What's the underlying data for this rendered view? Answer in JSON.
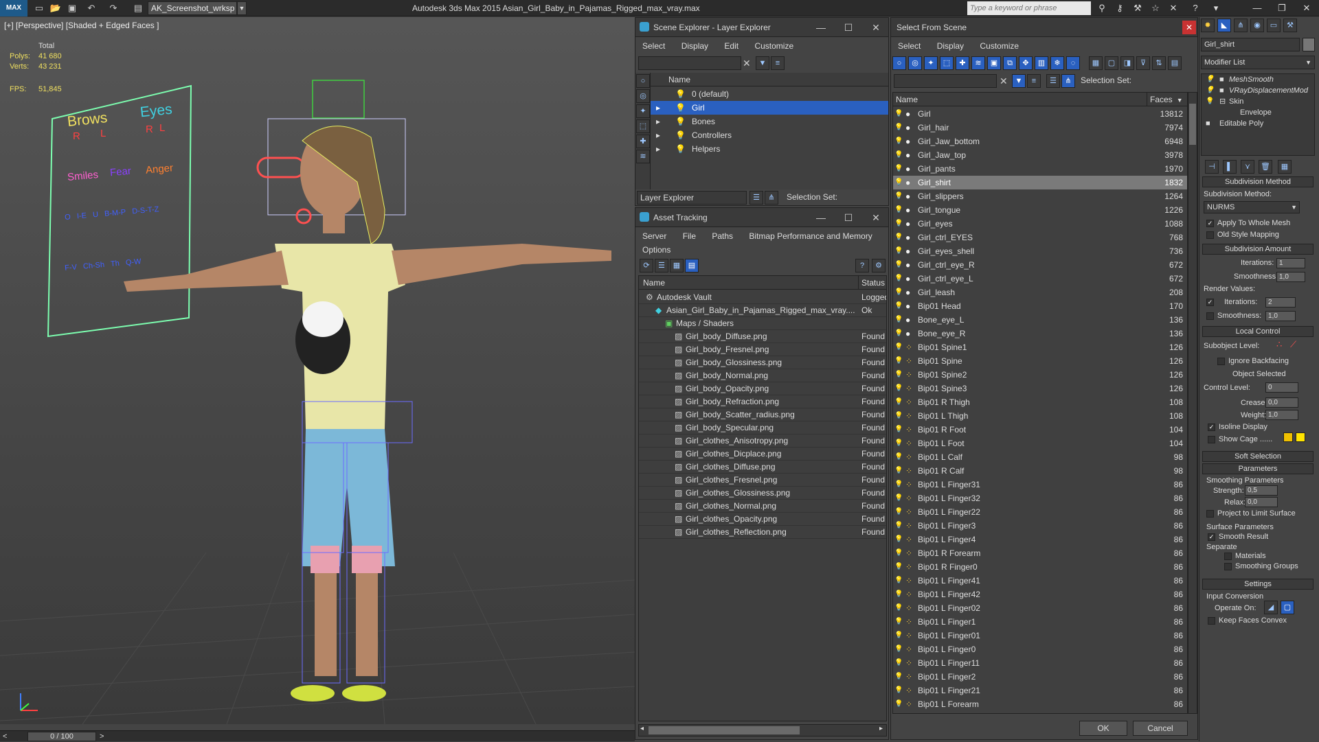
{
  "titlebar": {
    "logo": "MAX",
    "workspace": "AK_Screenshot_wrksp",
    "app_title": "Autodesk 3ds Max  2015     Asian_Girl_Baby_in_Pajamas_Rigged_max_vray.max",
    "search_placeholder": "Type a keyword or phrase"
  },
  "viewport": {
    "label": "[+] [Perspective] [Shaded + Edged Faces ]",
    "stats": {
      "total_label": "Total",
      "polys_label": "Polys:",
      "polys": "41 680",
      "verts_label": "Verts:",
      "verts": "43 231",
      "fps_label": "FPS:",
      "fps": "51,845"
    },
    "facial_panel": {
      "brows": "Brows",
      "eyes": "Eyes",
      "r1": "R",
      "l1": "L",
      "r2": "R",
      "l2": "L",
      "smiles": "Smiles",
      "fear": "Fear",
      "anger": "Anger",
      "row3": [
        "O",
        "I-E",
        "U",
        "B-M-P",
        "D-S-T-Z"
      ],
      "row4": [
        "F-V",
        "Ch-Sh",
        "Th",
        "Q-W"
      ]
    },
    "timeline": "0 / 100"
  },
  "scene_explorer": {
    "title": "Scene Explorer - Layer Explorer",
    "menu": [
      "Select",
      "Display",
      "Edit",
      "Customize"
    ],
    "column": "Name",
    "layers": [
      "0 (default)",
      "Girl",
      "Bones",
      "Controllers",
      "Helpers"
    ],
    "footer_dropdown": "Layer Explorer",
    "selection_set": "Selection Set:"
  },
  "asset_tracking": {
    "title": "Asset Tracking",
    "menu": [
      "Server",
      "File",
      "Paths",
      "Bitmap Performance and Memory",
      "Options"
    ],
    "col_name": "Name",
    "col_status": "Status",
    "rows": [
      {
        "name": "Autodesk Vault",
        "status": "Logged",
        "indent": 0
      },
      {
        "name": "Asian_Girl_Baby_in_Pajamas_Rigged_max_vray....",
        "status": "Ok",
        "indent": 1
      },
      {
        "name": "Maps / Shaders",
        "status": "",
        "indent": 2
      },
      {
        "name": "Girl_body_Diffuse.png",
        "status": "Found",
        "indent": 3
      },
      {
        "name": "Girl_body_Fresnel.png",
        "status": "Found",
        "indent": 3
      },
      {
        "name": "Girl_body_Glossiness.png",
        "status": "Found",
        "indent": 3
      },
      {
        "name": "Girl_body_Normal.png",
        "status": "Found",
        "indent": 3
      },
      {
        "name": "Girl_body_Opacity.png",
        "status": "Found",
        "indent": 3
      },
      {
        "name": "Girl_body_Refraction.png",
        "status": "Found",
        "indent": 3
      },
      {
        "name": "Girl_body_Scatter_radius.png",
        "status": "Found",
        "indent": 3
      },
      {
        "name": "Girl_body_Specular.png",
        "status": "Found",
        "indent": 3
      },
      {
        "name": "Girl_clothes_Anisotropy.png",
        "status": "Found",
        "indent": 3
      },
      {
        "name": "Girl_clothes_Dicplace.png",
        "status": "Found",
        "indent": 3
      },
      {
        "name": "Girl_clothes_Diffuse.png",
        "status": "Found",
        "indent": 3
      },
      {
        "name": "Girl_clothes_Fresnel.png",
        "status": "Found",
        "indent": 3
      },
      {
        "name": "Girl_clothes_Glossiness.png",
        "status": "Found",
        "indent": 3
      },
      {
        "name": "Girl_clothes_Normal.png",
        "status": "Found",
        "indent": 3
      },
      {
        "name": "Girl_clothes_Opacity.png",
        "status": "Found",
        "indent": 3
      },
      {
        "name": "Girl_clothes_Reflection.png",
        "status": "Found",
        "indent": 3
      }
    ]
  },
  "select_from_scene": {
    "title": "Select From Scene",
    "menu": [
      "Select",
      "Display",
      "Customize"
    ],
    "selection_set": "Selection Set:",
    "col_name": "Name",
    "col_faces": "Faces",
    "rows": [
      [
        "Girl",
        "13812"
      ],
      [
        "Girl_hair",
        "7974"
      ],
      [
        "Girl_Jaw_bottom",
        "6948"
      ],
      [
        "Girl_Jaw_top",
        "3978"
      ],
      [
        "Girl_pants",
        "1970"
      ],
      [
        "Girl_shirt",
        "1832"
      ],
      [
        "Girl_slippers",
        "1264"
      ],
      [
        "Girl_tongue",
        "1226"
      ],
      [
        "Girl_eyes",
        "1088"
      ],
      [
        "Girl_ctrl_EYES",
        "768"
      ],
      [
        "Girl_eyes_shell",
        "736"
      ],
      [
        "Girl_ctrl_eye_R",
        "672"
      ],
      [
        "Girl_ctrl_eye_L",
        "672"
      ],
      [
        "Girl_leash",
        "208"
      ],
      [
        "Bip01 Head",
        "170"
      ],
      [
        "Bone_eye_L",
        "136"
      ],
      [
        "Bone_eye_R",
        "136"
      ],
      [
        "Bip01 Spine1",
        "126"
      ],
      [
        "Bip01 Spine",
        "126"
      ],
      [
        "Bip01 Spine2",
        "126"
      ],
      [
        "Bip01 Spine3",
        "126"
      ],
      [
        "Bip01 R Thigh",
        "108"
      ],
      [
        "Bip01 L Thigh",
        "108"
      ],
      [
        "Bip01 R Foot",
        "104"
      ],
      [
        "Bip01 L Foot",
        "104"
      ],
      [
        "Bip01 L Calf",
        "98"
      ],
      [
        "Bip01 R Calf",
        "98"
      ],
      [
        "Bip01 L Finger31",
        "86"
      ],
      [
        "Bip01 L Finger32",
        "86"
      ],
      [
        "Bip01 L Finger22",
        "86"
      ],
      [
        "Bip01 L Finger3",
        "86"
      ],
      [
        "Bip01 L Finger4",
        "86"
      ],
      [
        "Bip01 R Forearm",
        "86"
      ],
      [
        "Bip01 R Finger0",
        "86"
      ],
      [
        "Bip01 L Finger41",
        "86"
      ],
      [
        "Bip01 L Finger42",
        "86"
      ],
      [
        "Bip01 L Finger02",
        "86"
      ],
      [
        "Bip01 L Finger1",
        "86"
      ],
      [
        "Bip01 L Finger01",
        "86"
      ],
      [
        "Bip01 L Finger0",
        "86"
      ],
      [
        "Bip01 L Finger11",
        "86"
      ],
      [
        "Bip01 L Finger2",
        "86"
      ],
      [
        "Bip01 L Finger21",
        "86"
      ],
      [
        "Bip01 L Forearm",
        "86"
      ]
    ],
    "selected_index": 5,
    "ok": "OK",
    "cancel": "Cancel"
  },
  "command_panel": {
    "object_name": "Girl_shirt",
    "modifier_list": "Modifier List",
    "stack": [
      "MeshSmooth",
      "VRayDisplacementMod",
      "Skin",
      "Envelope",
      "Editable Poly"
    ],
    "subdivision_method": {
      "title": "Subdivision Method",
      "label": "Subdivision Method:",
      "value": "NURMS",
      "apply_whole": "Apply To Whole Mesh",
      "old_style": "Old Style Mapping"
    },
    "subdivision_amount": {
      "title": "Subdivision Amount",
      "iterations_label": "Iterations:",
      "iterations": "1",
      "smoothness_label": "Smoothness:",
      "smoothness": "1,0",
      "render_values": "Render Values:",
      "r_iterations": "2",
      "r_smoothness": "1,0"
    },
    "local_control": {
      "title": "Local Control",
      "subobject": "Subobject Level:",
      "ignore_backfacing": "Ignore Backfacing",
      "object_selected": "Object Selected",
      "control_level_label": "Control Level:",
      "control_level": "0",
      "crease_label": "Crease:",
      "crease": "0,0",
      "weight_label": "Weight:",
      "weight": "1,0",
      "isoline": "Isoline Display",
      "show_cage": "Show Cage ......"
    },
    "soft_selection": "Soft Selection",
    "parameters": {
      "title": "Parameters",
      "smoothing_params": "Smoothing Parameters",
      "strength_label": "Strength:",
      "strength": "0,5",
      "relax_label": "Relax:",
      "relax": "0,0",
      "project": "Project to Limit Surface",
      "surface_params": "Surface Parameters",
      "smooth_result": "Smooth Result",
      "separate": "Separate",
      "materials": "Materials",
      "smoothing_groups": "Smoothing Groups"
    },
    "settings": {
      "title": "Settings",
      "input_conversion": "Input Conversion",
      "operate_on": "Operate On:",
      "keep_faces": "Keep Faces Convex"
    }
  },
  "colors": {
    "accent": "#2a60c0",
    "bulb": "#f7d84a",
    "cage1": "#f0c000",
    "cage2": "#ffe400"
  }
}
